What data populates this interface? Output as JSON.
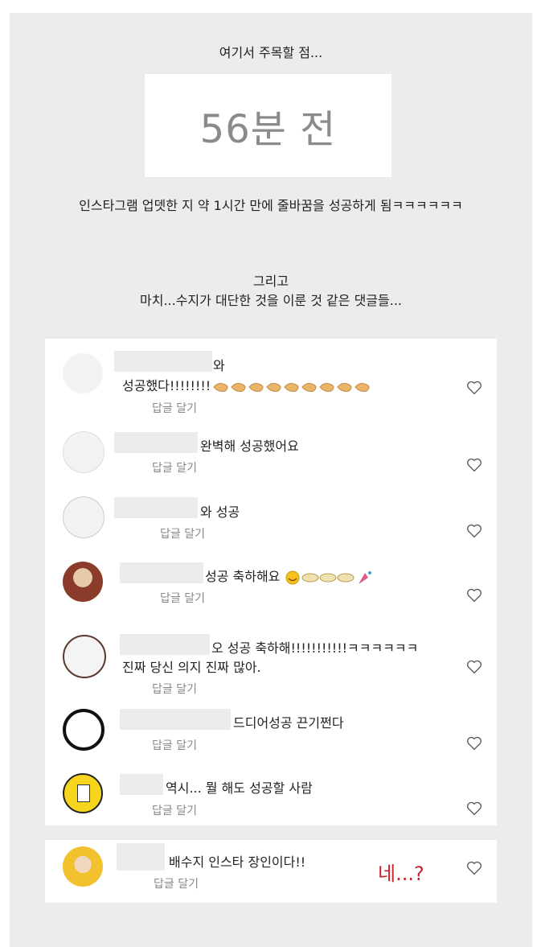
{
  "intro": {
    "caption1": "여기서 주목할 점...",
    "time_ago": "56분 전",
    "caption2": "인스타그램 업뎃한 지 약 1시간 만에 줄바꿈을 성공하게 됨ㅋㅋㅋㅋㅋㅋ",
    "caption3_line1": "그리고",
    "caption3_line2": "마치...수지가 대단한 것을 이룬 것 같은 댓글들..."
  },
  "reply_label": "답글 달기",
  "comments": [
    {
      "line1": "와",
      "line2": "성공했다!!!!!!!!"
    },
    {
      "line1": "완벽해 성공했어요"
    },
    {
      "line1": "와 성공"
    },
    {
      "line1": "성공 축하해요"
    },
    {
      "line1": "오 성공 축하해!!!!!!!!!!!ㅋㅋㅋㅋㅋㅋ",
      "line2": "진짜 당신 의지 진짜 많아."
    },
    {
      "line1": "드디어성공 끈기쩐다"
    },
    {
      "line1": "역시... 뭘 해도 성공할 사람"
    },
    {
      "line1": "배수지 인스타 장인이다!!"
    }
  ],
  "annotation": "네...?",
  "colors": {
    "panel_bg": "#ececec",
    "card_bg": "#ffffff",
    "annotation_red": "#c8232c",
    "muted": "#888888"
  }
}
